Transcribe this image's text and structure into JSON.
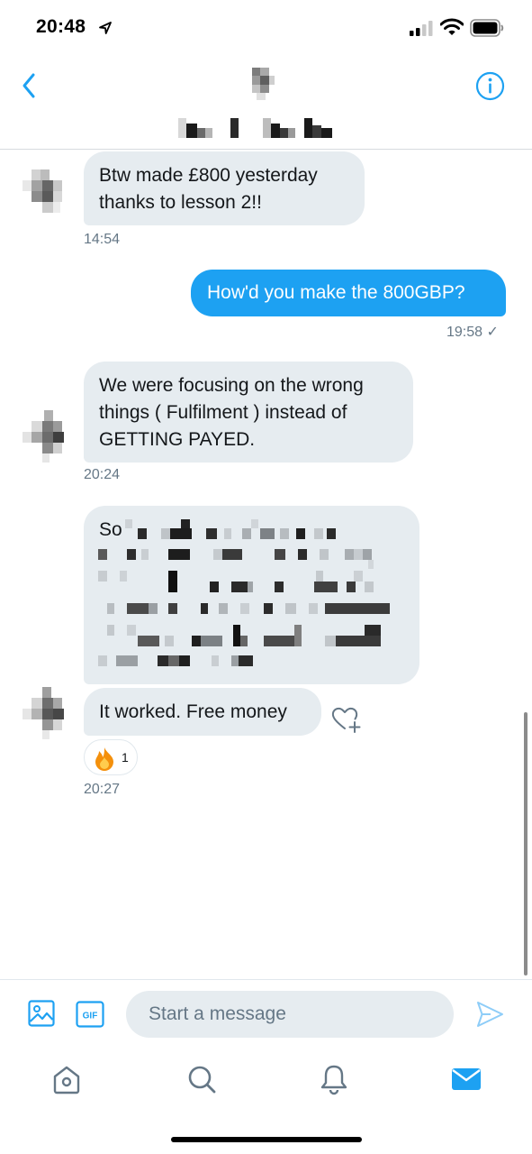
{
  "status_bar": {
    "time": "20:48"
  },
  "header": {
    "back_label": "Back",
    "info_label": "Conversation info"
  },
  "messages": [
    {
      "direction": "in",
      "text_lines": [
        "Btw made £800 yesterday",
        "thanks to lesson 2!!"
      ],
      "time": "14:54"
    },
    {
      "direction": "out",
      "text": "How'd you make the 800GBP?",
      "time": "19:58 ✓"
    },
    {
      "direction": "in",
      "text_lines": [
        "We were focusing on the wrong",
        "things ( Fulfilment ) instead of",
        "GETTING PAYED."
      ],
      "time": "20:24"
    },
    {
      "direction": "in",
      "text_start": "So",
      "redacted": true
    },
    {
      "direction": "in",
      "text": "It worked. Free money",
      "reaction": {
        "emoji": "🔥",
        "count": "1"
      },
      "time": "20:27"
    }
  ],
  "composer": {
    "placeholder": "Start a message",
    "gif_label": "GIF"
  },
  "tabs": [
    {
      "name": "home",
      "icon": "home-icon"
    },
    {
      "name": "search",
      "icon": "search-icon"
    },
    {
      "name": "notifications",
      "icon": "bell-icon"
    },
    {
      "name": "messages",
      "icon": "mail-icon",
      "active": true
    }
  ],
  "colors": {
    "accent": "#1da1f2",
    "incoming_bubble": "#e6ecf0",
    "timestamp": "#657786",
    "text": "#14171a"
  }
}
